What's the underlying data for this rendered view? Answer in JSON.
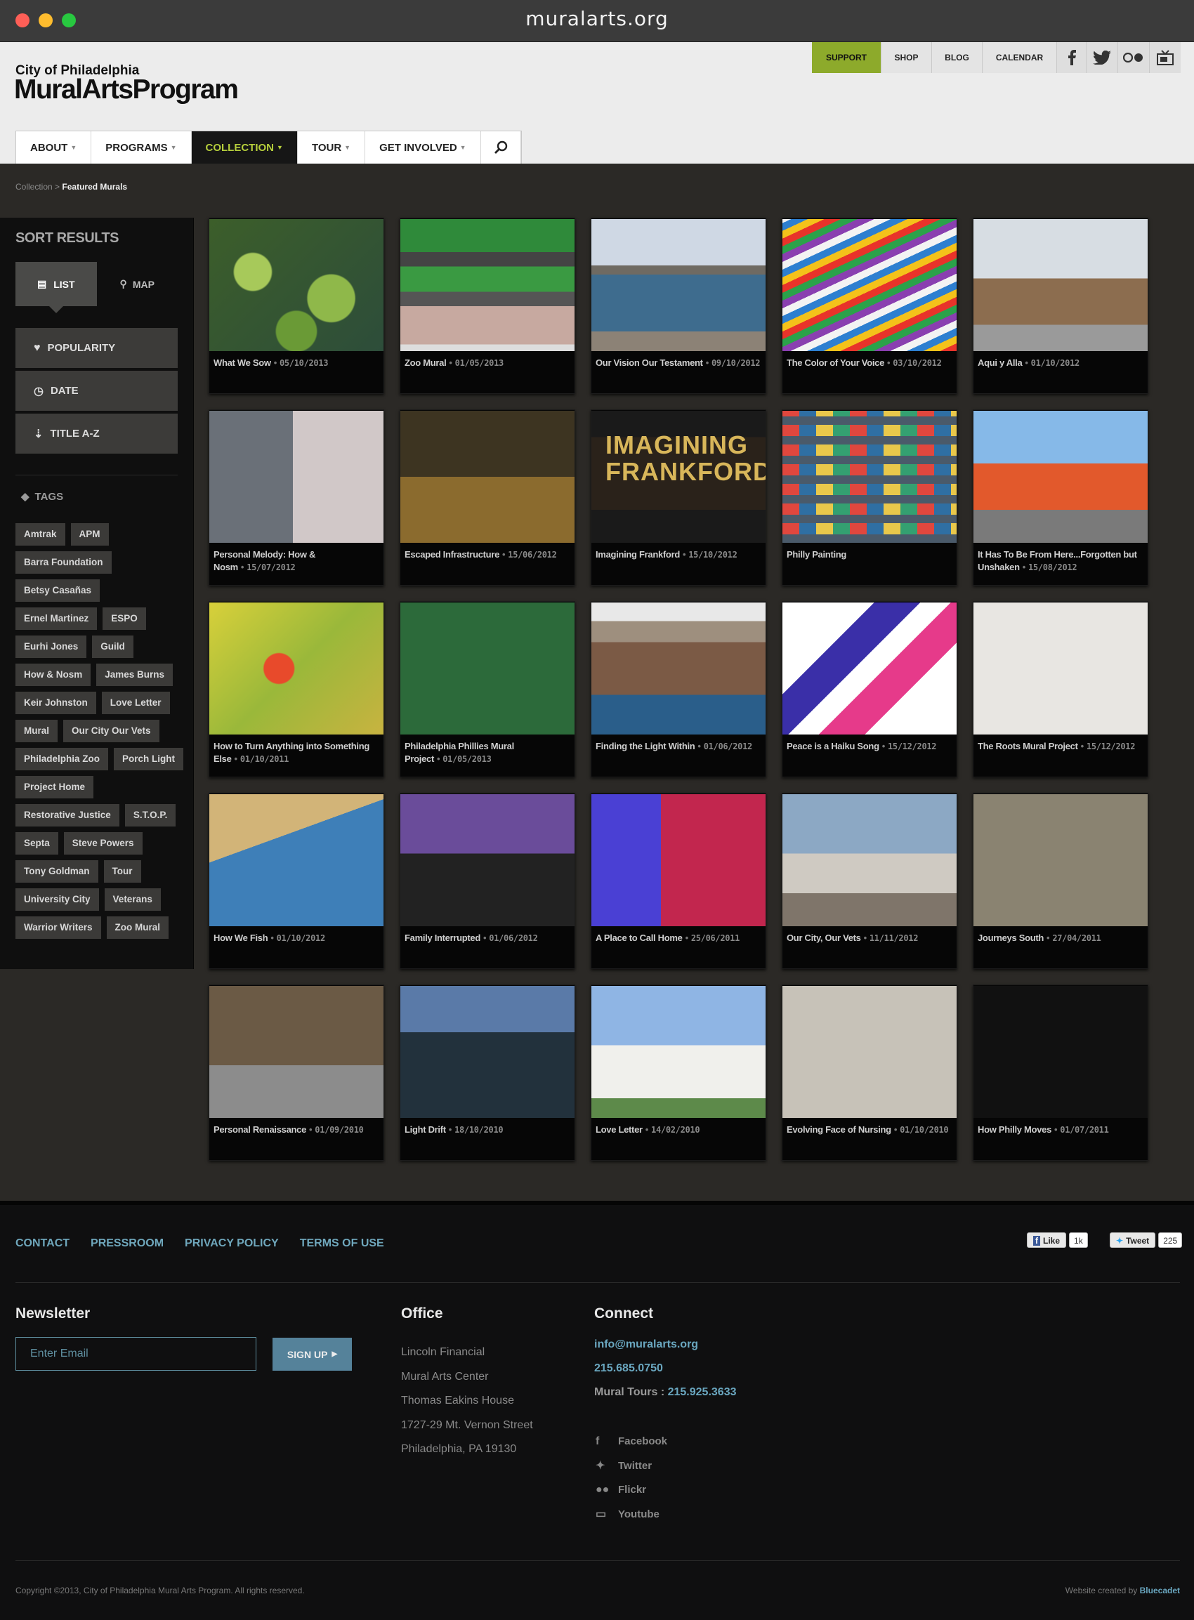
{
  "browser": {
    "url": "muralarts.org"
  },
  "brand": {
    "city": "City of Philadelphia",
    "name": "MuralArtsProgram"
  },
  "topnav": {
    "support": "SUPPORT",
    "shop": "SHOP",
    "blog": "BLOG",
    "calendar": "CALENDAR",
    "icons": [
      "facebook-icon",
      "twitter-icon",
      "flickr-icon",
      "youtube-icon"
    ]
  },
  "mainnav": [
    {
      "label": "ABOUT"
    },
    {
      "label": "PROGRAMS"
    },
    {
      "label": "COLLECTION",
      "active": true
    },
    {
      "label": "TOUR"
    },
    {
      "label": "GET INVOLVED"
    }
  ],
  "breadcrumb": {
    "parent": "Collection",
    "current": "Featured Murals"
  },
  "sidebar": {
    "heading": "SORT RESULTS",
    "list": "LIST",
    "map": "MAP",
    "sort": [
      "POPULARITY",
      "DATE",
      "TITLE A-Z"
    ],
    "tags_heading": "TAGS",
    "tags": [
      "Amtrak",
      "APM",
      "Barra Foundation",
      "Betsy Casañas",
      "Ernel Martinez",
      "ESPO",
      "Eurhi Jones",
      "Guild",
      "How & Nosm",
      "James Burns",
      "Keir Johnston",
      "Love Letter",
      "Mural",
      "Our City Our Vets",
      "Philadelphia Zoo",
      "Porch Light",
      "Project Home",
      "Restorative Justice",
      "S.T.O.P.",
      "Septa",
      "Steve Powers",
      "Tony Goldman",
      "Tour",
      "University City",
      "Veterans",
      "Warrior Writers",
      "Zoo Mural"
    ]
  },
  "murals": [
    {
      "title": "What We Sow",
      "date": "05/10/2013"
    },
    {
      "title": "Zoo Mural",
      "date": "01/05/2013"
    },
    {
      "title": "Our Vision Our Testament",
      "date": "09/10/2012"
    },
    {
      "title": "The Color of Your Voice",
      "date": "03/10/2012"
    },
    {
      "title": "Aqui y Alla",
      "date": "01/10/2012"
    },
    {
      "title": "Personal Melody: How & Nosm",
      "date": "15/07/2012"
    },
    {
      "title": "Escaped Infrastructure",
      "date": "15/06/2012"
    },
    {
      "title": "Imagining Frankford",
      "date": "15/10/2012"
    },
    {
      "title": "Philly Painting",
      "date": ""
    },
    {
      "title": "It Has To Be From Here...Forgotten but Unshaken",
      "date": "15/08/2012"
    },
    {
      "title": "How to Turn Anything into Something Else",
      "date": "01/10/2011"
    },
    {
      "title": "Philadelphia Phillies Mural Project",
      "date": "01/05/2013"
    },
    {
      "title": "Finding the Light Within",
      "date": "01/06/2012"
    },
    {
      "title": "Peace is a Haiku Song",
      "date": "15/12/2012"
    },
    {
      "title": "The Roots Mural Project",
      "date": "15/12/2012"
    },
    {
      "title": "How We Fish",
      "date": "01/10/2012"
    },
    {
      "title": "Family Interrupted",
      "date": "01/06/2012"
    },
    {
      "title": "A Place to Call Home",
      "date": "25/06/2011"
    },
    {
      "title": "Our City, Our Vets",
      "date": "11/11/2012"
    },
    {
      "title": "Journeys South",
      "date": "27/04/2011"
    },
    {
      "title": "Personal Renaissance",
      "date": "01/09/2010"
    },
    {
      "title": "Light Drift",
      "date": "18/10/2010"
    },
    {
      "title": "Love Letter",
      "date": "14/02/2010"
    },
    {
      "title": "Evolving Face of Nursing",
      "date": "01/10/2010"
    },
    {
      "title": "How Philly Moves",
      "date": "01/07/2011"
    }
  ],
  "thumb_text": {
    "imagining": "IMAGINING FRANKFORD"
  },
  "footer": {
    "links": [
      "CONTACT",
      "PRESSROOM",
      "PRIVACY POLICY",
      "TERMS OF USE"
    ],
    "like": "Like",
    "like_count": "1k",
    "tweet": "Tweet",
    "tweet_count": "225",
    "newsletter": {
      "heading": "Newsletter",
      "placeholder": "Enter Email",
      "button": "SIGN UP"
    },
    "office": {
      "heading": "Office",
      "lines": [
        "Lincoln Financial",
        "Mural Arts Center",
        "Thomas Eakins House",
        "1727-29 Mt. Vernon Street",
        "Philadelphia, PA 19130"
      ]
    },
    "connect": {
      "heading": "Connect",
      "email": "info@muralarts.org",
      "phone": "215.685.0750",
      "tours_label": "Mural Tours :",
      "tours_phone": "215.925.3633",
      "social": [
        "Facebook",
        "Twitter",
        "Flickr",
        "Youtube"
      ]
    },
    "copyright": "Copyright ©2013, City of Philadelphia Mural Arts Program. All rights reserved.",
    "credit_label": "Website created by",
    "credit_name": "Bluecadet"
  },
  "colors": {
    "accent": "#8daa2b",
    "active_nav": "#b6cf3c",
    "link": "#6fa7bc",
    "page_bg": "#2b2926",
    "footer_bg": "#0f0f10"
  }
}
